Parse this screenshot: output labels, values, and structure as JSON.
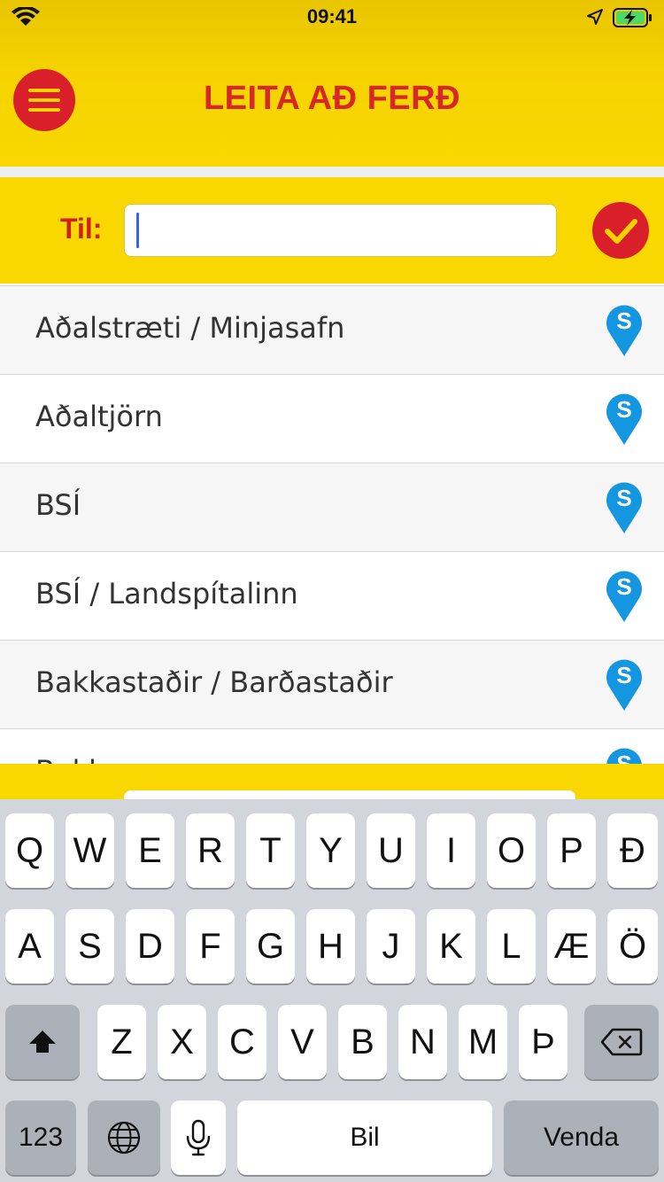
{
  "status_bar": {
    "time": "09:41"
  },
  "header": {
    "title": "LEITA AÐ FERÐ"
  },
  "search": {
    "label": "Til:",
    "value": "",
    "placeholder": ""
  },
  "stops": [
    {
      "name": "Aðalstræti / Minjasafn"
    },
    {
      "name": "Aðaltjörn"
    },
    {
      "name": "BSÍ"
    },
    {
      "name": "BSÍ / Landspítalinn"
    },
    {
      "name": "Bakkastaðir / Barðastaðir"
    },
    {
      "name": "Bakkar"
    }
  ],
  "keyboard": {
    "row1": [
      "Q",
      "W",
      "E",
      "R",
      "T",
      "Y",
      "U",
      "I",
      "O",
      "P",
      "Ð"
    ],
    "row2": [
      "A",
      "S",
      "D",
      "F",
      "G",
      "H",
      "J",
      "K",
      "L",
      "Æ",
      "Ö"
    ],
    "row3": [
      "Z",
      "X",
      "C",
      "V",
      "B",
      "N",
      "M",
      "Þ"
    ],
    "numbers_key": "123",
    "space_key": "Bil",
    "return_key": "Venda"
  },
  "colors": {
    "brand_yellow": "#f8d800",
    "brand_red": "#d9202a",
    "stop_pin_blue": "#1496e0"
  }
}
